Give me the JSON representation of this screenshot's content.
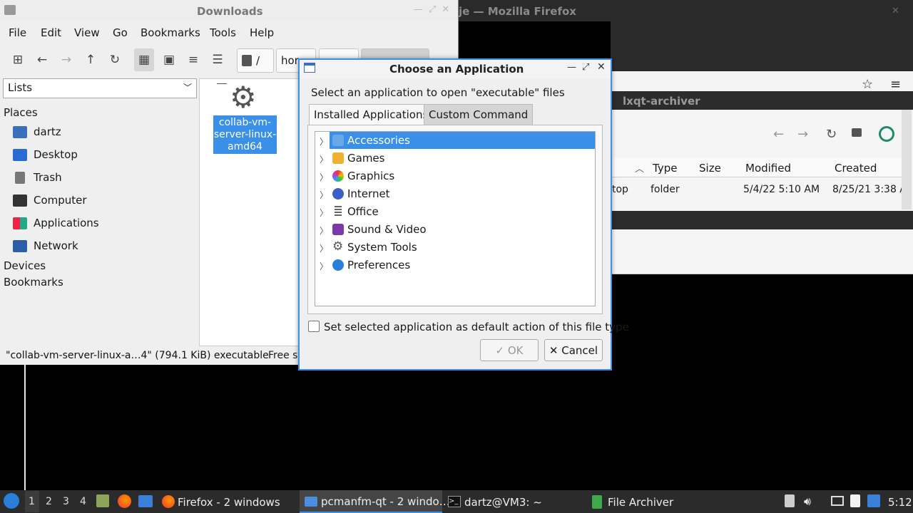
{
  "firefox": {
    "title": "je — Mozilla Firefox"
  },
  "archiver": {
    "title": "lxqt-archiver",
    "columns": [
      "Type",
      "Size",
      "Modified",
      "Created"
    ],
    "row": {
      "name": "top",
      "type": "folder",
      "size": "",
      "modified": "5/4/22 5:10 AM",
      "created": "8/25/21 3:38 A"
    }
  },
  "filemanager": {
    "title": "Downloads",
    "menu": [
      "File",
      "Edit",
      "View",
      "Go",
      "Bookmarks",
      "Tools",
      "Help"
    ],
    "path": [
      "/",
      "hor"
    ],
    "side_select": "Lists",
    "places_header": "Places",
    "places": [
      "dartz",
      "Desktop",
      "Trash",
      "Computer",
      "Applications",
      "Network"
    ],
    "devices_header": "Devices",
    "bookmarks_header": "Bookmarks",
    "file_name": "collab-vm-server-linux-amd64",
    "file_lines": [
      "collab-vm-",
      "server-linux-",
      "amd64"
    ],
    "status": "\"collab-vm-server-linux-a…4\" (794.1 KiB) executable",
    "status_free": "Free s"
  },
  "dialog": {
    "title": "Choose an Application",
    "prompt": "Select an application to open \"executable\" files",
    "tabs": [
      "Installed Applications",
      "Custom Command"
    ],
    "categories": [
      "Accessories",
      "Games",
      "Graphics",
      "Internet",
      "Office",
      "Sound & Video",
      "System Tools",
      "Preferences"
    ],
    "checkbox_label": "Set selected application as default action of this file type",
    "ok_label": "✓ OK",
    "cancel_label": "✕ Cancel"
  },
  "taskbar": {
    "desktops": [
      "1",
      "2",
      "3",
      "4"
    ],
    "tasks": [
      "Firefox - 2 windows",
      "pcmanfm-qt - 2 windo…",
      "dartz@VM3: ~",
      "File Archiver"
    ],
    "clock": "5:12"
  },
  "colors": {
    "accent": "#3a8fe8",
    "taskbar": "#2b2b2b"
  }
}
